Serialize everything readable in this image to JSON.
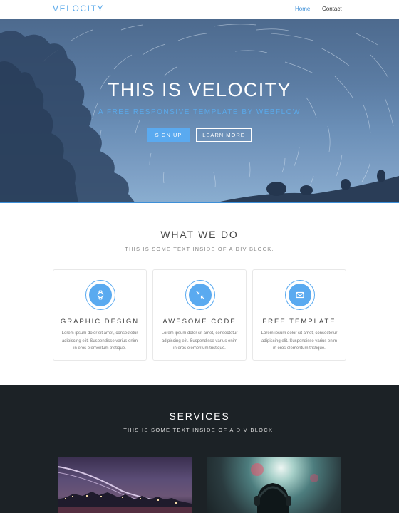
{
  "nav": {
    "brand": "VELOCITY",
    "links": [
      {
        "label": "Home",
        "active": true
      },
      {
        "label": "Contact",
        "active": false
      }
    ]
  },
  "hero": {
    "title": "THIS IS VELOCITY",
    "subtitle": "A FREE RESPONSIVE TEMPLATE BY WEBFLOW",
    "signup_label": "SIGN UP",
    "learn_label": "LEARN MORE"
  },
  "what": {
    "title": "WHAT WE DO",
    "subtitle": "THIS IS SOME TEXT INSIDE OF A DIV BLOCK.",
    "cards": [
      {
        "icon": "watch-icon",
        "title": "GRAPHIC DESIGN",
        "text": "Lorem ipsum dolor sit amet, consectetur adipiscing elit. Suspendisse varius enim in eros elementum tristique."
      },
      {
        "icon": "compress-arrows-icon",
        "title": "AWESOME CODE",
        "text": "Lorem ipsum dolor sit amet, consectetur adipiscing elit. Suspendisse varius enim in eros elementum tristique."
      },
      {
        "icon": "envelope-icon",
        "title": "FREE TEMPLATE",
        "text": "Lorem ipsum dolor sit amet, consectetur adipiscing elit. Suspendisse varius enim in eros elementum tristique."
      }
    ]
  },
  "services": {
    "title": "SERVICES",
    "subtitle": "THIS IS SOME TEXT INSIDE OF A DIV BLOCK."
  },
  "colors": {
    "accent": "#5aaaf0",
    "dark_section": "#1c2226"
  }
}
